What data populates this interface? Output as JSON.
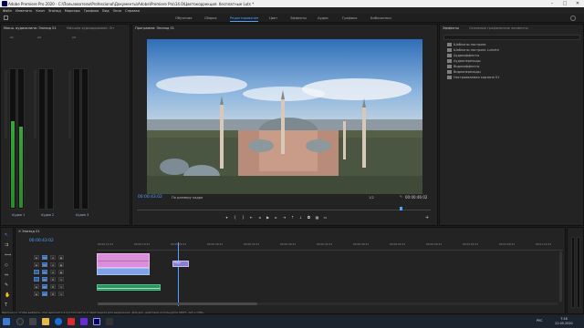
{
  "titlebar": {
    "title": "Adobe Premiere Pro 2020 - C:\\Пользователи\\Professional\\Документы\\Adobe\\Premiere Pro\\14.0\\Цветокоррекция. бесплатные Luts *",
    "minimize": "–",
    "maximize": "□",
    "close": "✕"
  },
  "menu": [
    "Файл",
    "Изменить",
    "Клип",
    "Эпизод",
    "Маркеры",
    "Графика",
    "Вид",
    "Окно",
    "Справка"
  ],
  "workspaces": [
    {
      "label": "Обучение",
      "active": false
    },
    {
      "label": "Сборка",
      "active": false
    },
    {
      "label": "Редактирование",
      "active": true
    },
    {
      "label": "Цвет",
      "active": false
    },
    {
      "label": "Эффекты",
      "active": false
    },
    {
      "label": "Аудио",
      "active": false
    },
    {
      "label": "Графика",
      "active": false
    },
    {
      "label": "Библиотеки",
      "active": false
    }
  ],
  "mixer": {
    "tab1": "Микш. аудиоклипа: Эпизод 01",
    "tab2": "Микшер аудиодорожек: Эп",
    "channels": [
      {
        "name": "Аудио 1",
        "levels": [
          0.62,
          0.58
        ]
      },
      {
        "name": "Аудио 2",
        "levels": [
          0.0,
          0.0
        ]
      },
      {
        "name": "Аудио 3",
        "levels": [
          0.0,
          0.0
        ]
      }
    ],
    "header_labels": [
      "A1",
      "A2",
      "A3"
    ]
  },
  "program": {
    "title": "Программа: Эпизод 01",
    "timecode": "00:00:43:02",
    "fit": "По размеру кадра",
    "fraction": "1/2",
    "duration": "00:00:46:02",
    "colors": {
      "accent": "#4da3ff"
    }
  },
  "effects": {
    "tab1": "Эффекты",
    "tab2": "Основные графические элементы",
    "items": [
      "Шаблоны настроек",
      "Шаблоны настроек Lumetri",
      "Аудиоэффекты",
      "Аудиопереходы",
      "Видеоэффекты",
      "Видеопереходы",
      "Настраиваемая корзина 01"
    ]
  },
  "timeline": {
    "tab": "Эпизод 01",
    "timecode": "00:00:43:02",
    "ruler": [
      "00:00:14:23",
      "00:00:19:23",
      "00:00:24:23",
      "00:00:29:23",
      "00:00:34:23",
      "00:00:39:23",
      "00:00:44:23",
      "00:00:49:23",
      "00:00:54:23",
      "00:00:59:23",
      "00:01:04:23",
      "00:01:09:23",
      "00:01:14:23"
    ],
    "tracks": [
      {
        "label": "V3"
      },
      {
        "label": "V2"
      },
      {
        "label": "V1"
      },
      {
        "label": "A1"
      },
      {
        "label": "A2"
      },
      {
        "label": "A3"
      }
    ],
    "adjustment_clip": "Корр"
  },
  "status": "Щелкните, чтобы выбрать, или щелкните в пустом месте и перетащите для выделения. Для доп. действий используйте SHIFT, ALT и CTRL.",
  "taskbar": {
    "lang": "РУС",
    "time": "7:16",
    "date": "22.05.2020"
  }
}
